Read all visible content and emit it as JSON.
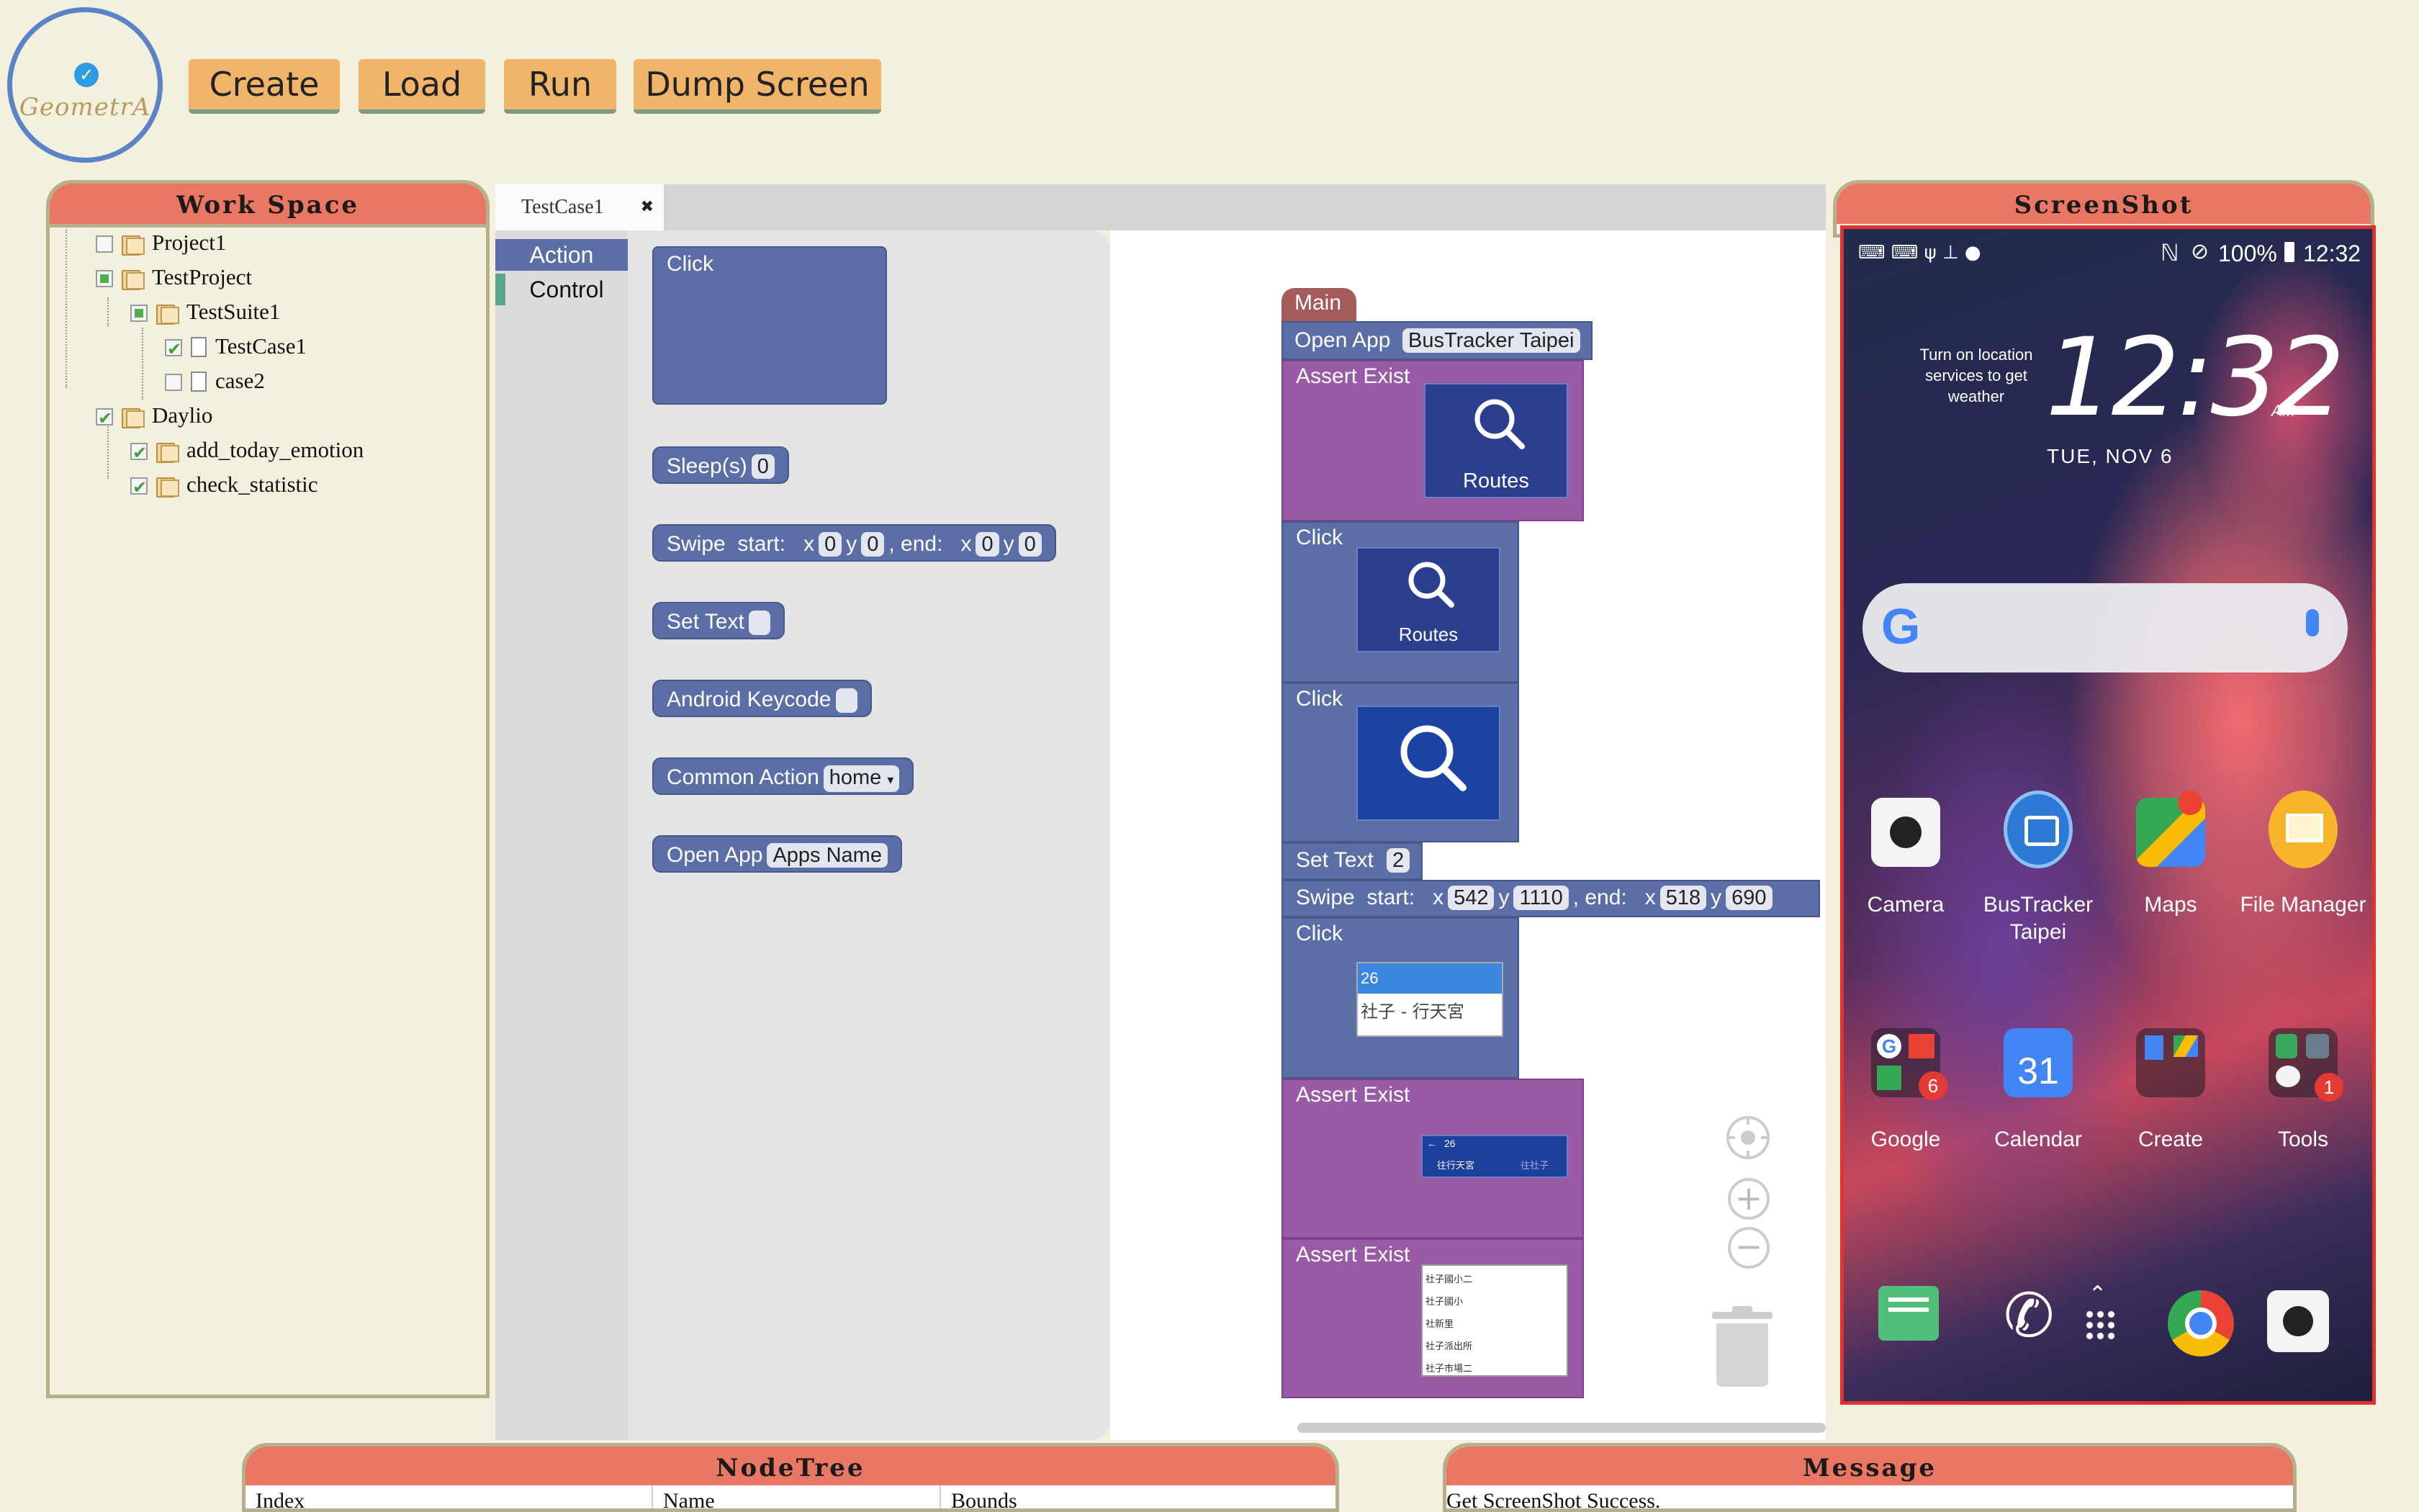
{
  "logo": {
    "text": "GeometrA"
  },
  "toolbar": {
    "create_label": "Create",
    "load_label": "Load",
    "run_label": "Run",
    "dump_label": "Dump Screen"
  },
  "workspace": {
    "title": "Work Space",
    "tree": [
      {
        "label": "Project1",
        "state": "unchecked",
        "type": "folder",
        "level": 0
      },
      {
        "label": "TestProject",
        "state": "partial",
        "type": "folder",
        "level": 0
      },
      {
        "label": "TestSuite1",
        "state": "partial",
        "type": "folder",
        "level": 1
      },
      {
        "label": "TestCase1",
        "state": "checked",
        "type": "file",
        "level": 2
      },
      {
        "label": "case2",
        "state": "unchecked",
        "type": "file",
        "level": 2
      },
      {
        "label": "Daylio",
        "state": "checked",
        "type": "folder",
        "level": 0
      },
      {
        "label": "add_today_emotion",
        "state": "checked",
        "type": "folder",
        "level": 1
      },
      {
        "label": "check_statistic",
        "state": "checked",
        "type": "folder",
        "level": 1
      }
    ]
  },
  "editor": {
    "tab_label": "TestCase1",
    "toolbox": [
      "Action",
      "Control"
    ],
    "flyout": {
      "click": "Click",
      "sleep": "Sleep(s)",
      "sleep_val": "0",
      "swipe": "Swipe",
      "start": "start:",
      "end": ", end:",
      "x": "x",
      "y": "y",
      "zero": "0",
      "set_text": "Set Text",
      "keycode": "Android Keycode",
      "common_action": "Common Action",
      "common_action_val": "home",
      "open_app": "Open App",
      "open_app_val": "Apps Name"
    },
    "program": {
      "main": "Main",
      "open_app": "Open App",
      "open_app_val": "BusTracker Taipei",
      "assert_exist": "Assert Exist",
      "click": "Click",
      "routes": "Routes",
      "set_text": "Set Text",
      "set_text_val": "2",
      "swipe": "Swipe",
      "start": "start:",
      "end": ", end:",
      "x": "x",
      "y": "y",
      "swipe_vals": [
        "542",
        "1110",
        "518",
        "690"
      ],
      "list_top": "26",
      "list_item": "社子 - 行天宮",
      "mini_header": "26",
      "mini_a": "往行天宮",
      "mini_b": "往社子",
      "mini_list": [
        "社子國小二",
        "社子國小",
        "社新里",
        "社子派出所",
        "社子市場二"
      ]
    }
  },
  "screenshot": {
    "title": "ScreenShot",
    "battery": "100%",
    "status_time": "12:32",
    "weather_hint": "Turn on location services to get weather",
    "clock": "12:32",
    "ampm": "AM",
    "date": "TUE, NOV 6",
    "apps_row1": [
      "Camera",
      "BusTracker Taipei",
      "Maps",
      "File Manager"
    ],
    "apps_row2": [
      "Google",
      "Calendar",
      "Create",
      "Tools"
    ],
    "calendar_day": "31",
    "badge_google": "6",
    "badge_tools": "1"
  },
  "nodetree": {
    "title": "NodeTree",
    "columns": [
      "Index",
      "Name",
      "Bounds"
    ]
  },
  "message": {
    "title": "Message",
    "text": "Get ScreenShot Success."
  }
}
